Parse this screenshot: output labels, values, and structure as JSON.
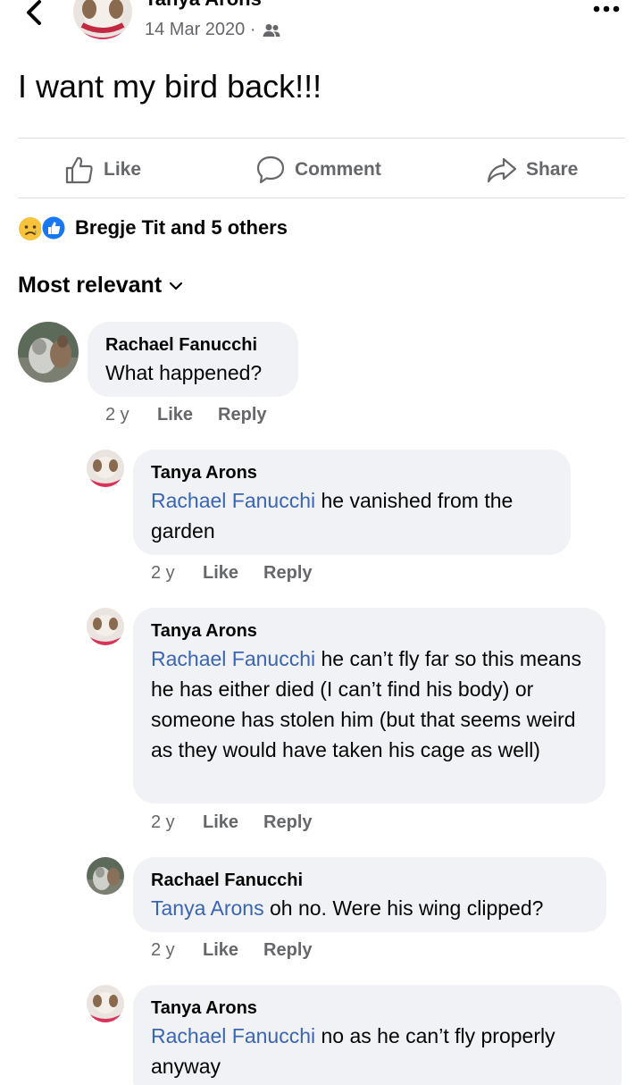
{
  "post": {
    "author": "Tanya Arons",
    "date": "14 Mar 2020 ·",
    "audience_icon": "friends-icon",
    "text": "I want my bird back!!!"
  },
  "actions": {
    "like": "Like",
    "comment": "Comment",
    "share": "Share"
  },
  "reactions": {
    "names": "Bregje Tit and 5 others",
    "icons": [
      "sad-reaction-icon",
      "like-reaction-icon"
    ]
  },
  "sort": {
    "label": "Most relevant"
  },
  "comments": [
    {
      "author": "Rachael Fanucchi",
      "mention": "",
      "text": "What happened?",
      "time": "2 y",
      "like": "Like",
      "reply": "Reply"
    },
    {
      "author": "Tanya Arons",
      "mention": "Rachael Fanucchi",
      "text": " he vanished from the garden",
      "time": "2 y",
      "like": "Like",
      "reply": "Reply"
    },
    {
      "author": "Tanya Arons",
      "mention": "Rachael Fanucchi",
      "text": " he can’t fly far so this means he has either died (I can’t find his body) or someone has stolen him (but that seems weird as they would have taken his cage as well)",
      "time": "2 y",
      "like": "Like",
      "reply": "Reply"
    },
    {
      "author": "Rachael Fanucchi",
      "mention": "Tanya Arons",
      "text": " oh no. Were his wing clipped?",
      "time": "2 y",
      "like": "Like",
      "reply": "Reply"
    },
    {
      "author": "Tanya Arons",
      "mention": "Rachael Fanucchi",
      "text": " no as he can’t fly properly anyway",
      "time": "",
      "like": "",
      "reply": ""
    }
  ],
  "colors": {
    "mention": "#3a64b4",
    "bubble": "#f0f2f5",
    "secondary_text": "#65676b",
    "like_blue": "#1877f2",
    "sad_yellow": "#f7c23c"
  }
}
